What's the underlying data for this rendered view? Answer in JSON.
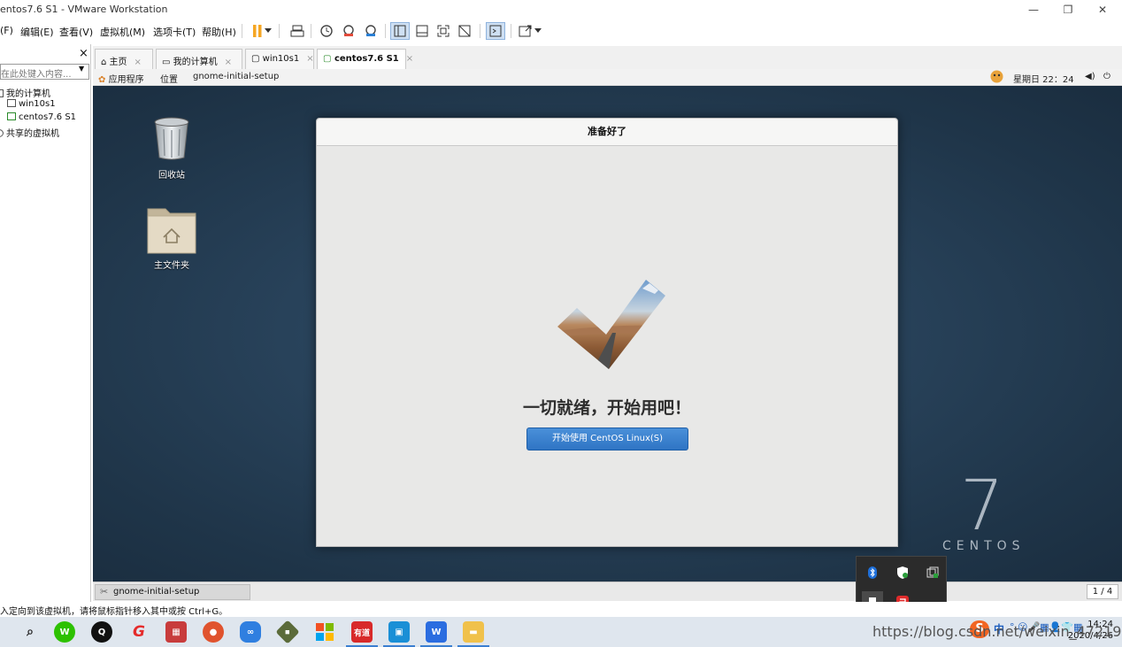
{
  "window": {
    "title": "entos7.6 S1 - VMware Workstation",
    "controls": [
      "—",
      "❐",
      "✕"
    ]
  },
  "menubar": {
    "items": [
      "(F)",
      "编辑(E)",
      "查看(V)",
      "虚拟机(M)",
      "选项卡(T)",
      "帮助(H)"
    ]
  },
  "library": {
    "close": "×",
    "search_placeholder": "在此处键入内容...",
    "items": [
      {
        "label": "我的计算机",
        "level": 0
      },
      {
        "label": "win10s1",
        "level": 1
      },
      {
        "label": "centos7.6 S1",
        "level": 1
      },
      {
        "label": "共享的虚拟机",
        "level": 0
      }
    ]
  },
  "tabs": [
    {
      "label": "主页",
      "icon": "home-icon",
      "active": false
    },
    {
      "label": "我的计算机",
      "icon": "monitor-icon",
      "active": false
    },
    {
      "label": "win10s1",
      "icon": "vm-icon",
      "active": false
    },
    {
      "label": "centos7.6 S1",
      "icon": "vm-running-icon",
      "active": true
    }
  ],
  "gnome_topbar": {
    "apps": "应用程序",
    "places": "位置",
    "current_app": "gnome-initial-setup",
    "clock": "星期日 22：24"
  },
  "desktop": {
    "icons": [
      {
        "label": "回收站",
        "icon": "trash-icon"
      },
      {
        "label": "主文件夹",
        "icon": "home-folder-icon"
      }
    ],
    "brand_number": "7",
    "brand_text": "CENTOS"
  },
  "dialog": {
    "title": "准备好了",
    "message": "一切就绪，开始用吧！",
    "button": "开始使用 CentOS Linux(S)"
  },
  "gnome_taskbar": {
    "task": "gnome-initial-setup",
    "workspace": "1 / 4"
  },
  "statusbar": {
    "text": "入定向到该虚拟机，请将鼠标指针移入其中或按 Ctrl+G。"
  },
  "win_taskbar": {
    "time": "14:24",
    "date": "2020/4/26",
    "watermark": "https://blog.csdn.net/weixin_47219935",
    "ime": "中"
  },
  "colors": {
    "accent": "#3b7fd1",
    "dialog_button": "#2f74c4",
    "pause": "#f5a623"
  }
}
